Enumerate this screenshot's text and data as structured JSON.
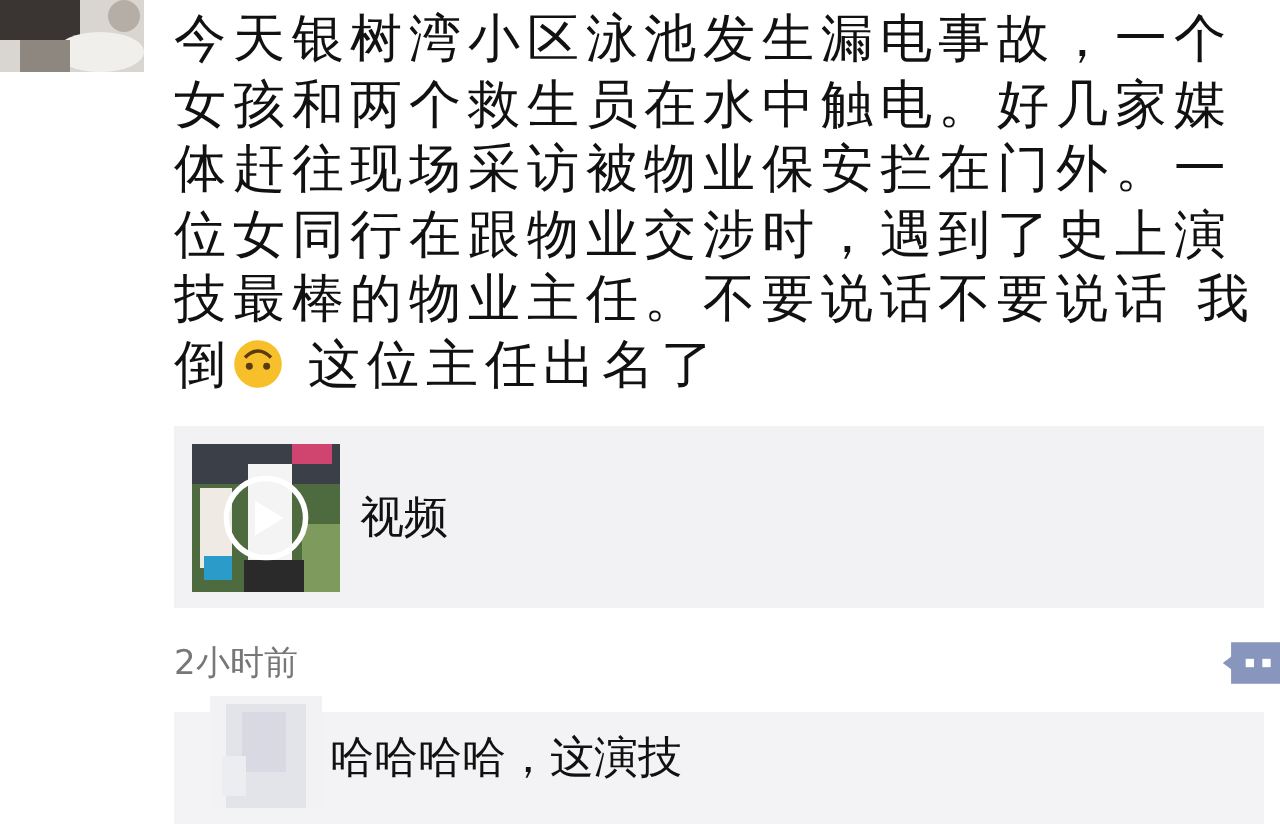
{
  "post": {
    "text_before": "今天银树湾小区泳池发生漏电事故，一个女孩和两个救生员在水中触电。好几家媒体赶往现场采访被物业保安拦在门外。一位女同行在跟物业交涉时，遇到了史上演技最棒的物业主任。不要说话不要说话 我倒",
    "text_after": " 这位主任出名了"
  },
  "video_card": {
    "label": "视频"
  },
  "time": "2小时前",
  "comments": [
    {
      "text": "哈哈哈哈，这演技"
    }
  ]
}
